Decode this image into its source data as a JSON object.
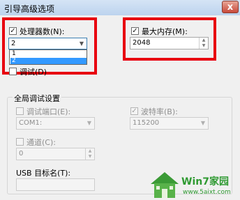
{
  "window": {
    "title": "引导高级选项",
    "close_glyph": "x"
  },
  "processors": {
    "label": "处理器数(N):",
    "checked": true,
    "value": "2",
    "options": [
      "1",
      "2"
    ],
    "selected_index": 1
  },
  "memory": {
    "label": "最大内存(M):",
    "checked": true,
    "value": "2048"
  },
  "debug": {
    "label": "调试(D)"
  },
  "global_debug": {
    "heading": "全局调试设置",
    "debug_port": {
      "label": "调试端口(E):",
      "value": "COM1:"
    },
    "baud_rate": {
      "label": "波特率(B):",
      "value": "115200",
      "checked": true
    },
    "channel": {
      "label": "通道(C):",
      "value": "0"
    },
    "usb_target": {
      "label": "USB 目标名(T):",
      "value": ""
    }
  },
  "watermark": {
    "brand": "Win7家园",
    "url": "www.5aixt.com"
  },
  "colors": {
    "highlight_box": "#e8000f",
    "selection": "#3399ff",
    "brand_green": "#2f9a32"
  }
}
